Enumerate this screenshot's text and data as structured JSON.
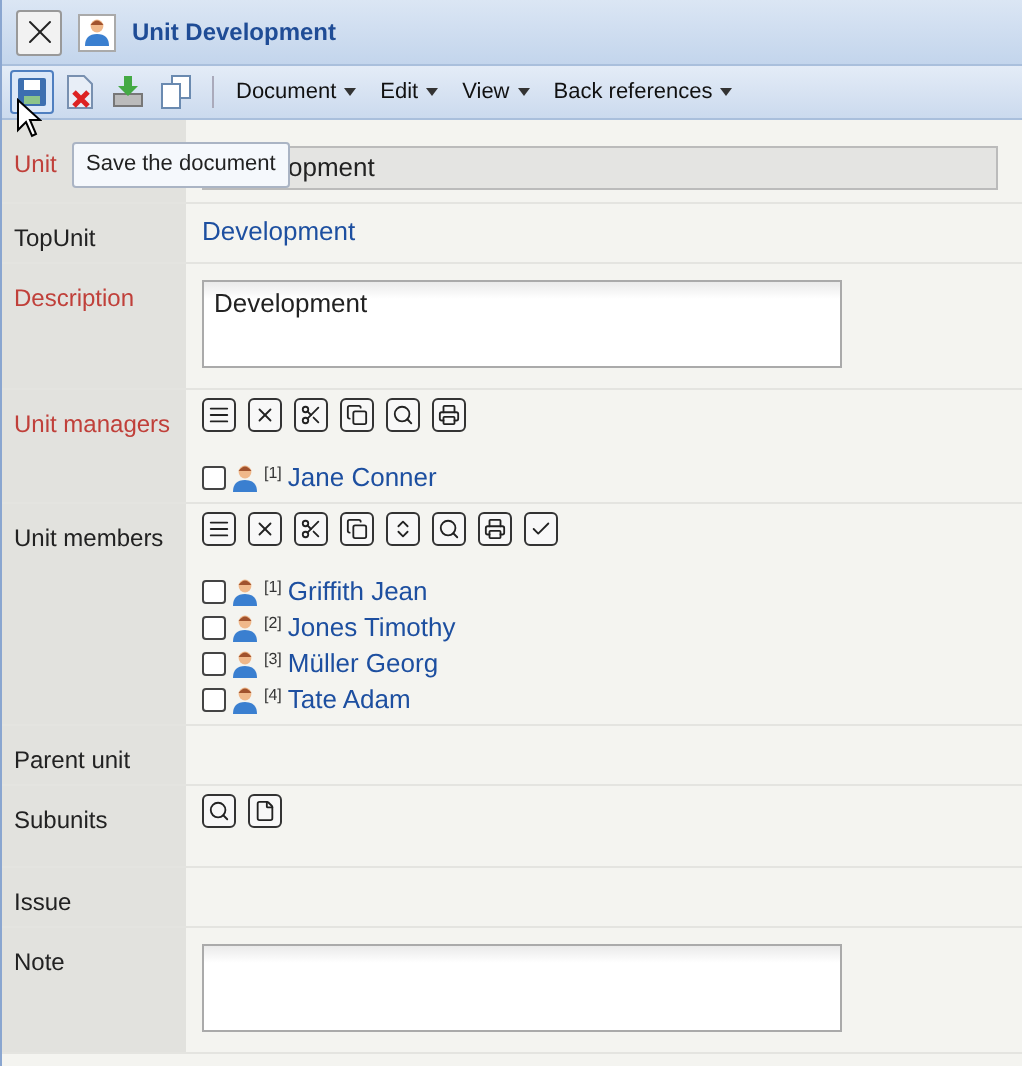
{
  "window": {
    "title": "Unit Development"
  },
  "toolbar": {
    "buttons": [
      {
        "kind": "save",
        "hovered": true
      },
      {
        "kind": "delete",
        "hovered": false
      },
      {
        "kind": "import",
        "hovered": false
      },
      {
        "kind": "copy",
        "hovered": false
      }
    ],
    "menus": [
      "Document",
      "Edit",
      "View",
      "Back references"
    ]
  },
  "tooltip": "Save the document",
  "rows": [
    {
      "label": "Unit",
      "required": true,
      "kind": "field",
      "value": "opment"
    },
    {
      "label": "TopUnit",
      "required": false,
      "kind": "link",
      "value": "Development"
    },
    {
      "label": "Description",
      "required": true,
      "kind": "textarea",
      "value": "Development"
    },
    {
      "label": "Unit managers",
      "required": true,
      "kind": "list",
      "actions": [
        {
          "kind": "top"
        },
        {
          "kind": "remove"
        },
        {
          "kind": "cut"
        },
        {
          "kind": "copy"
        },
        {
          "kind": "search"
        },
        {
          "kind": "print"
        }
      ],
      "items": [
        {
          "index": "[1]",
          "name": "Jane Conner",
          "checked": false
        }
      ]
    },
    {
      "label": "Unit members",
      "required": false,
      "kind": "list",
      "actions": [
        {
          "kind": "top"
        },
        {
          "kind": "remove"
        },
        {
          "kind": "cut"
        },
        {
          "kind": "copy"
        },
        {
          "kind": "sort"
        },
        {
          "kind": "search"
        },
        {
          "kind": "print"
        },
        {
          "kind": "check"
        }
      ],
      "items": [
        {
          "index": "[1]",
          "name": "Griffith Jean",
          "checked": false
        },
        {
          "index": "[2]",
          "name": "Jones Timothy",
          "checked": false
        },
        {
          "index": "[3]",
          "name": "Müller Georg",
          "checked": false
        },
        {
          "index": "[4]",
          "name": "Tate Adam",
          "checked": false
        }
      ]
    },
    {
      "label": "Parent unit",
      "required": false,
      "kind": "empty"
    },
    {
      "label": "Subunits",
      "required": false,
      "kind": "list",
      "actions": [
        {
          "kind": "search"
        },
        {
          "kind": "new"
        }
      ],
      "items": []
    },
    {
      "label": "Issue",
      "required": false,
      "kind": "empty"
    },
    {
      "label": "Note",
      "required": false,
      "kind": "textarea",
      "value": ""
    }
  ]
}
